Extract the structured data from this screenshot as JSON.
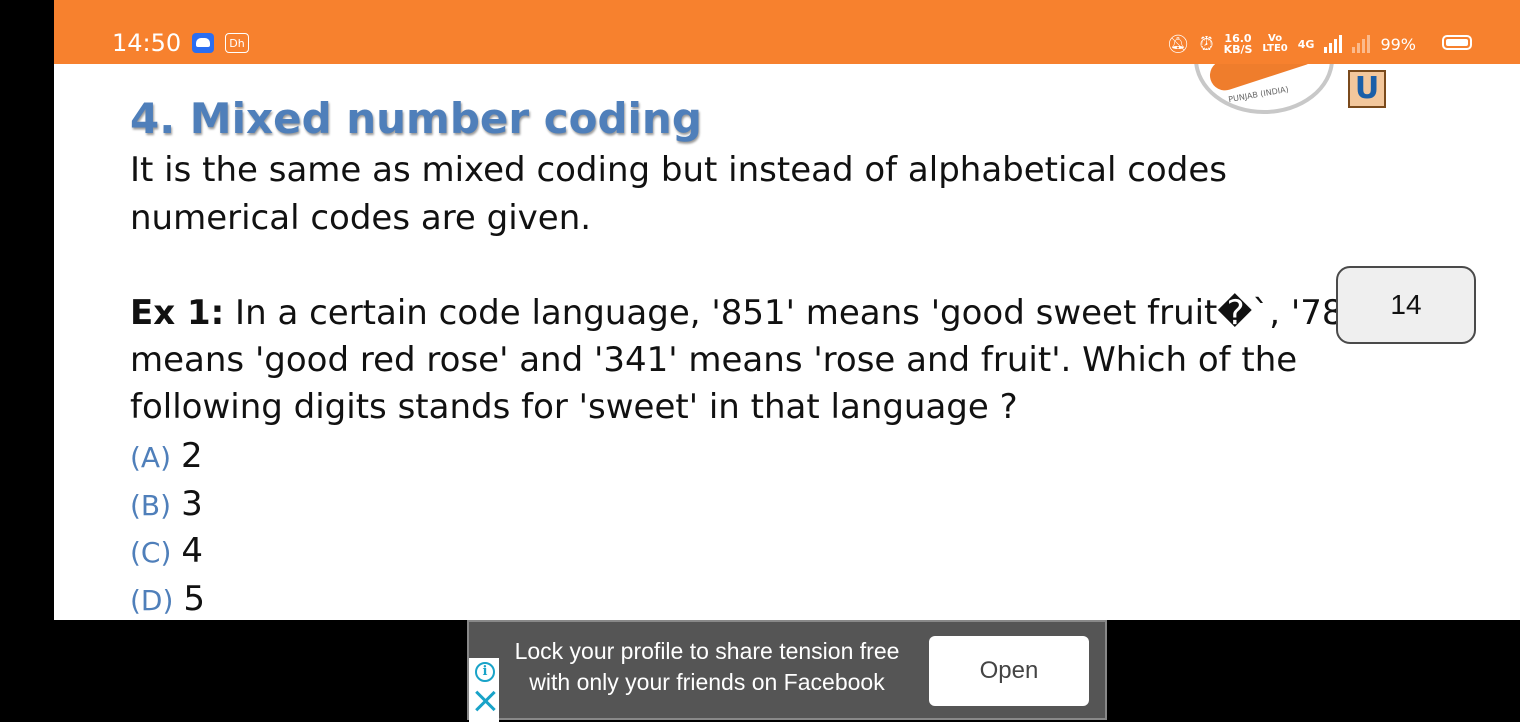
{
  "status_bar": {
    "time": "14:50",
    "app_badge_b": "Dh",
    "speed_value": "16.0",
    "speed_unit": "KB/S",
    "volte_top": "Vo",
    "volte_bottom": "LTE0",
    "network": "4G",
    "battery_percent": "99%",
    "background_color": "#f7812e"
  },
  "slide": {
    "logo_text": "PUNJAB (INDIA)",
    "badge_letter": "U",
    "heading": "4. Mixed number coding",
    "paragraph": "It is the same as mixed coding but instead of alphabetical codes numerical codes are given.",
    "example_label": "Ex 1:",
    "example_text": " In a certain code language, '851' means 'good sweet fruit�`,  '783‵ means 'good red rose' and '341' means 'rose and fruit'. Which of the following digits stands for 'sweet' in that language ?",
    "options": [
      {
        "letter": "(A)",
        "value": "2"
      },
      {
        "letter": "(B)",
        "value": "3"
      },
      {
        "letter": "(C)",
        "value": "4"
      },
      {
        "letter": "(D)",
        "value": "5"
      }
    ],
    "heading_color": "#4f7fba"
  },
  "page_number": "14",
  "ad": {
    "info_icon": "info-icon",
    "close_icon": "close-icon",
    "text": "Lock your profile to share tension free with only your friends on Facebook",
    "button_label": "Open"
  }
}
